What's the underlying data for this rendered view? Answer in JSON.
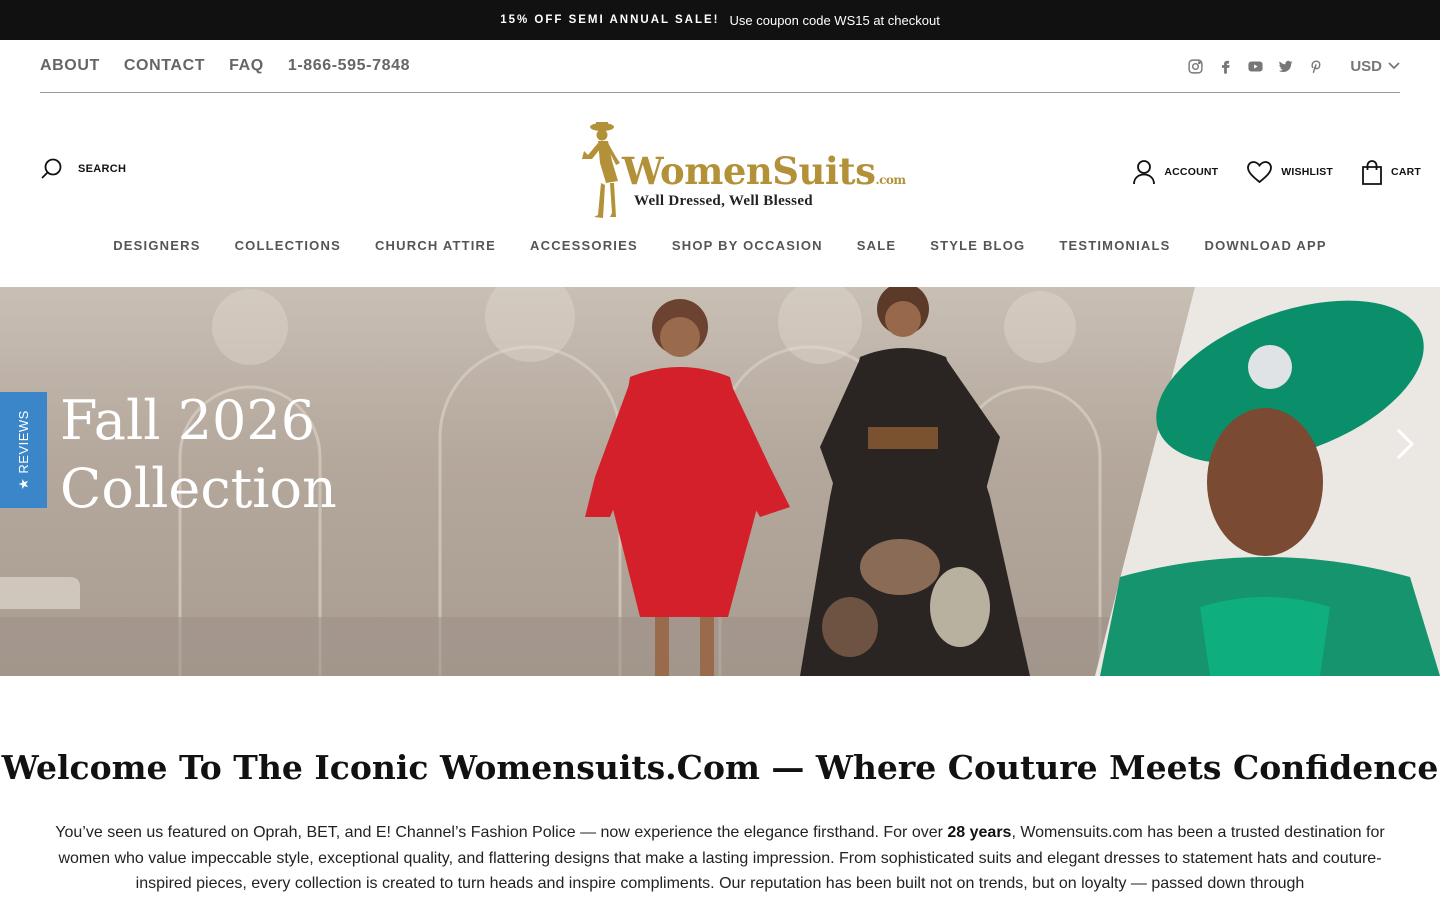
{
  "announcement": {
    "strong": "15% OFF SEMI ANNUAL SALE!",
    "text": "Use coupon code WS15 at checkout"
  },
  "utility_links": [
    "ABOUT",
    "CONTACT",
    "FAQ",
    "1-866-595-7848"
  ],
  "social_icons": [
    "instagram-icon",
    "facebook-icon",
    "youtube-icon",
    "twitter-icon",
    "pinterest-icon"
  ],
  "currency": "USD",
  "search": {
    "label": "SEARCH"
  },
  "logo": {
    "brand": "WomenSuits",
    "suffix": ".com",
    "tagline": "Well Dressed, Well Blessed"
  },
  "header_actions": {
    "account": "ACCOUNT",
    "wishlist": "WISHLIST",
    "cart": "CART"
  },
  "main_nav": [
    "DESIGNERS",
    "COLLECTIONS",
    "CHURCH ATTIRE",
    "ACCESSORIES",
    "SHOP BY OCCASION",
    "SALE",
    "STYLE BLOG",
    "TESTIMONIALS",
    "DOWNLOAD APP"
  ],
  "hero": {
    "title_line1": "Fall 2026",
    "title_line2": "Collection"
  },
  "reviews_tab": "★ REVIEWS",
  "welcome": {
    "title": "Welcome To The Iconic Womensuits.Com — Where Couture Meets Confidence",
    "body_part1": "You’ve seen us featured on Oprah, BET, and E! Channel’s Fashion Police — now experience the elegance firsthand. For over ",
    "body_bold": "28 years",
    "body_part2": ", Womensuits.com has been a trusted destination for women who value impeccable style, exceptional quality, and flattering designs that make a lasting impression. From sophisticated suits and elegant dresses to statement hats and couture-inspired pieces, every collection is created to turn heads and inspire compliments. Our reputation has been built not on trends, but on loyalty — passed down through"
  },
  "colors": {
    "announcement_bg": "#111111",
    "brand_gold": "#b39139",
    "reviews_blue": "#3a86c8"
  }
}
